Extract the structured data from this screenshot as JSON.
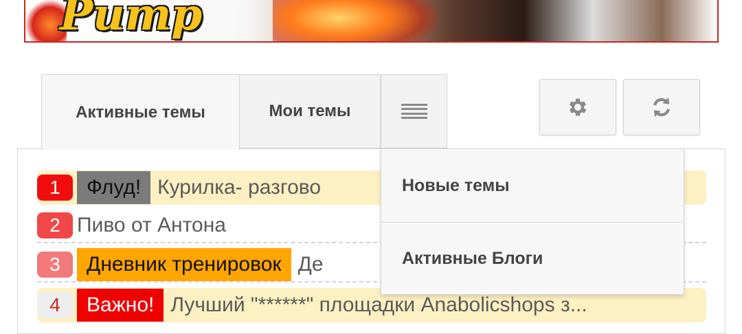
{
  "banner": {
    "logo_text": "Pump"
  },
  "tabs": [
    {
      "label": "Активные темы",
      "active": true
    },
    {
      "label": "Мои темы",
      "active": false
    }
  ],
  "toolbar": {
    "menu_icon": "hamburger-icon",
    "settings_icon": "gear-icon",
    "refresh_icon": "refresh-icon"
  },
  "dropdown": {
    "items": [
      {
        "label": "Новые темы"
      },
      {
        "label": "Активные Блоги"
      }
    ]
  },
  "topics": [
    {
      "rank": "1",
      "label": "Флуд!",
      "title": "Курилка- разгово",
      "highlighted": true
    },
    {
      "rank": "2",
      "label": "",
      "title": "Пиво от Антона",
      "highlighted": false
    },
    {
      "rank": "3",
      "label": "Дневник тренировок",
      "title": "Де",
      "highlighted": false
    },
    {
      "rank": "4",
      "label": "Важно!",
      "title": "Лучший \"******\" площадки Anabolicshops з...",
      "highlighted": true
    }
  ],
  "colors": {
    "accent_red": "#f20d0d",
    "label_flood": "#7b7b7b",
    "label_diary": "#ffa500",
    "label_important": "#f00000",
    "highlight_row": "#fdf0c2"
  }
}
